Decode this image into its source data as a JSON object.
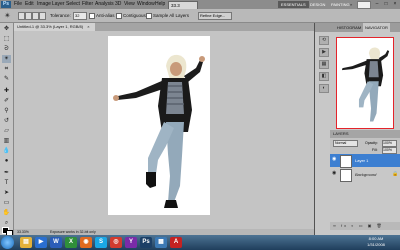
{
  "app": {
    "logo": "Ps",
    "menu": [
      "File",
      "Edit",
      "Image",
      "Layer",
      "Select",
      "Filter",
      "Analysis",
      "3D",
      "View",
      "Window",
      "Help"
    ],
    "zoom_value": "33.3",
    "workspaces": [
      "ESSENTIALS",
      "DESIGN",
      "PAINTING"
    ],
    "workspace_more": "»",
    "search_placeholder": "",
    "window_controls": [
      "–",
      "□",
      "×"
    ]
  },
  "options_bar": {
    "tolerance_label": "Tolerance:",
    "tolerance_value": "32",
    "antialias_label": "Anti-alias",
    "contiguous_label": "Contiguous",
    "sample_all_label": "Sample All Layers",
    "refine_label": "Refine Edge..."
  },
  "document": {
    "tab_title": "Untitled-1 @ 33.3% (Layer 1, RGB/8)",
    "tab_close": "×",
    "status_zoom": "33.33%",
    "status_text": "Exposure works in 32-bit only"
  },
  "navigator": {
    "tabs": [
      "HISTOGRAM",
      "NAVIGATOR"
    ]
  },
  "layers": {
    "title": "LAYERS",
    "blend_mode": "Normal",
    "opacity_label": "Opacity:",
    "opacity_value": "100%",
    "fill_label": "Fill:",
    "fill_value": "100%",
    "rows": [
      {
        "name": "Layer 1",
        "selected": true
      },
      {
        "name": "Background",
        "selected": false
      }
    ],
    "footer_icons": "∞ fx ◐ ▭ ▣ 🗑"
  },
  "taskbar": {
    "apps": [
      {
        "icon": "explorer",
        "glyph": "▤",
        "color": "#e3b13a"
      },
      {
        "icon": "media-player",
        "glyph": "▶",
        "color": "#2a6fd0"
      },
      {
        "icon": "word",
        "glyph": "W",
        "color": "#2b5db8"
      },
      {
        "icon": "excel",
        "glyph": "X",
        "color": "#2f8f3a"
      },
      {
        "icon": "firefox",
        "glyph": "◉",
        "color": "#e06a1f"
      },
      {
        "icon": "skype",
        "glyph": "S",
        "color": "#1aa7e6"
      },
      {
        "icon": "chrome",
        "glyph": "◎",
        "color": "#d23b2f"
      },
      {
        "icon": "yahoo-messenger",
        "glyph": "Y",
        "color": "#7a2ba8"
      },
      {
        "icon": "photoshop",
        "glyph": "Ps",
        "color": "#1c3f66"
      },
      {
        "icon": "folder",
        "glyph": "▦",
        "color": "#3c79b4"
      },
      {
        "icon": "pdf",
        "glyph": "A",
        "color": "#c42222"
      }
    ],
    "clock_time": "8:00 AM",
    "clock_date": "1/31/2008"
  }
}
